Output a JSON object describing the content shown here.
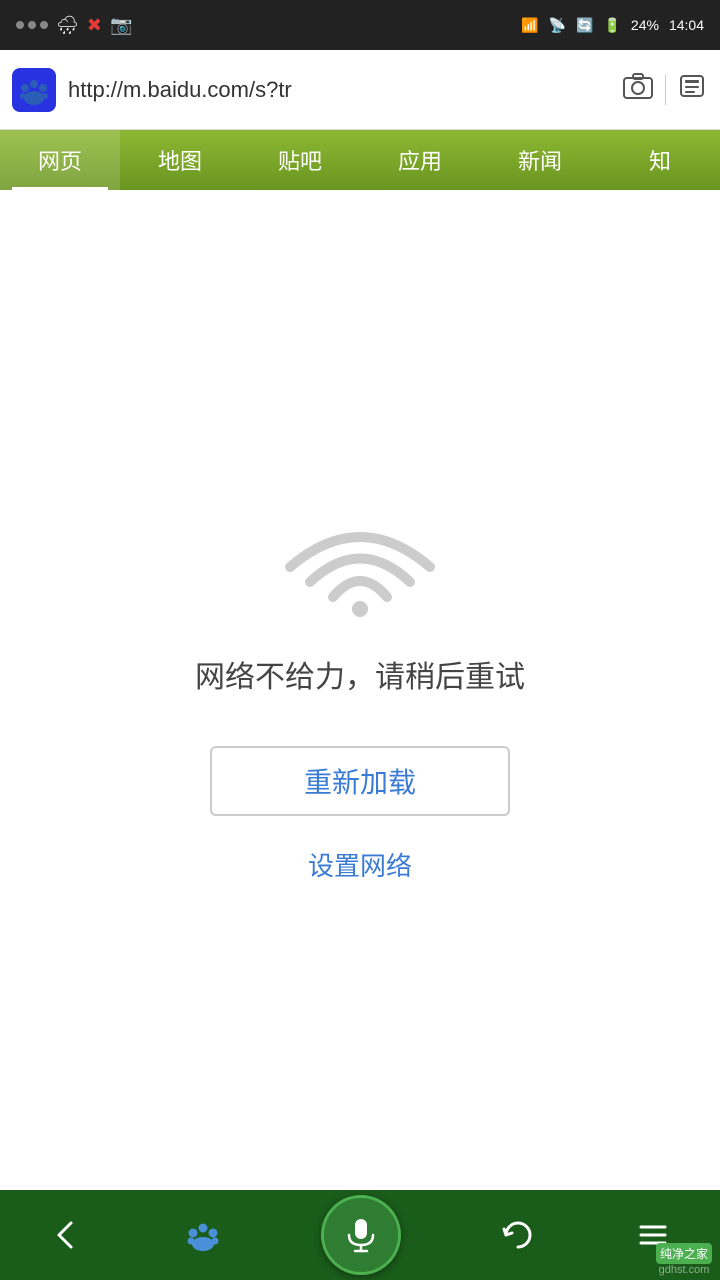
{
  "statusBar": {
    "time": "14:04",
    "battery": "24%",
    "dots": 3
  },
  "addressBar": {
    "logoText": "du",
    "url": "http://m.baidu.com/s?tr",
    "cameraIconLabel": "camera-icon",
    "tabIconLabel": "tab-icon"
  },
  "navTabs": [
    {
      "label": "网页",
      "active": true
    },
    {
      "label": "地图",
      "active": false
    },
    {
      "label": "贴吧",
      "active": false
    },
    {
      "label": "应用",
      "active": false
    },
    {
      "label": "新闻",
      "active": false
    },
    {
      "label": "知",
      "active": false
    }
  ],
  "errorPage": {
    "errorMessage": "网络不给力，请稍后重试",
    "reloadButton": "重新加载",
    "networkSettings": "设置网络"
  },
  "bottomBar": {
    "backLabel": "←",
    "homeLabel": "du",
    "micLabel": "🎤",
    "refreshLabel": "↻",
    "menuLabel": "≡",
    "watermark": "纯净之家\ngdhst.com"
  }
}
